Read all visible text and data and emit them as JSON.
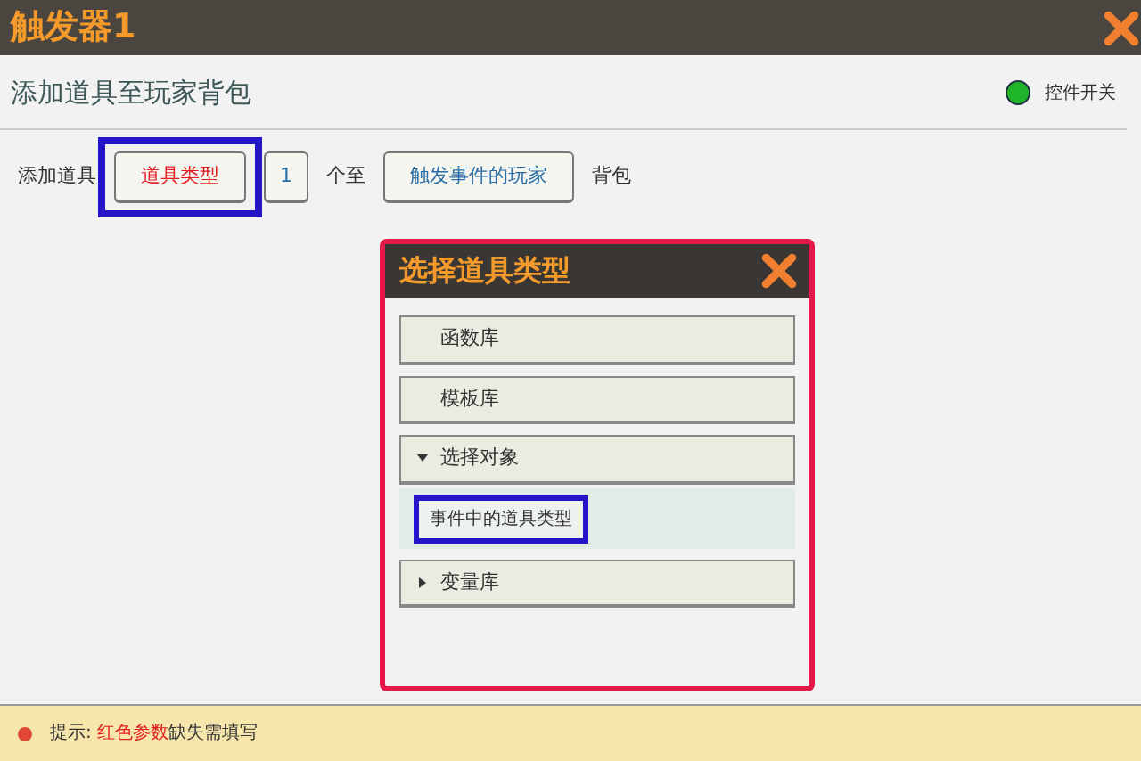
{
  "window": {
    "title": "触发器1"
  },
  "section": {
    "title": "添加道具至玩家背包",
    "toggle": {
      "label": "控件开关",
      "on": true
    }
  },
  "statement": [
    {
      "kind": "text",
      "text": "添加道具"
    },
    {
      "kind": "param",
      "text": "道具类型",
      "missing": true,
      "highlighted": true
    },
    {
      "kind": "number",
      "text": "1"
    },
    {
      "kind": "text",
      "text": "个至"
    },
    {
      "kind": "param",
      "text": "触发事件的玩家",
      "missing": false
    },
    {
      "kind": "text",
      "text": "背包"
    }
  ],
  "dialog": {
    "title": "选择道具类型",
    "highlighted": true,
    "items": [
      {
        "kind": "entry",
        "label": "函数库"
      },
      {
        "kind": "entry",
        "label": "模板库"
      },
      {
        "kind": "group",
        "label": "选择对象",
        "expanded": true,
        "children": [
          {
            "label": "事件中的道具类型",
            "highlighted": true
          }
        ]
      },
      {
        "kind": "group",
        "label": "变量库",
        "expanded": false
      }
    ]
  },
  "hint": {
    "label": "提示:",
    "emphasis": "红色参数",
    "rest": "缺失需填写"
  }
}
